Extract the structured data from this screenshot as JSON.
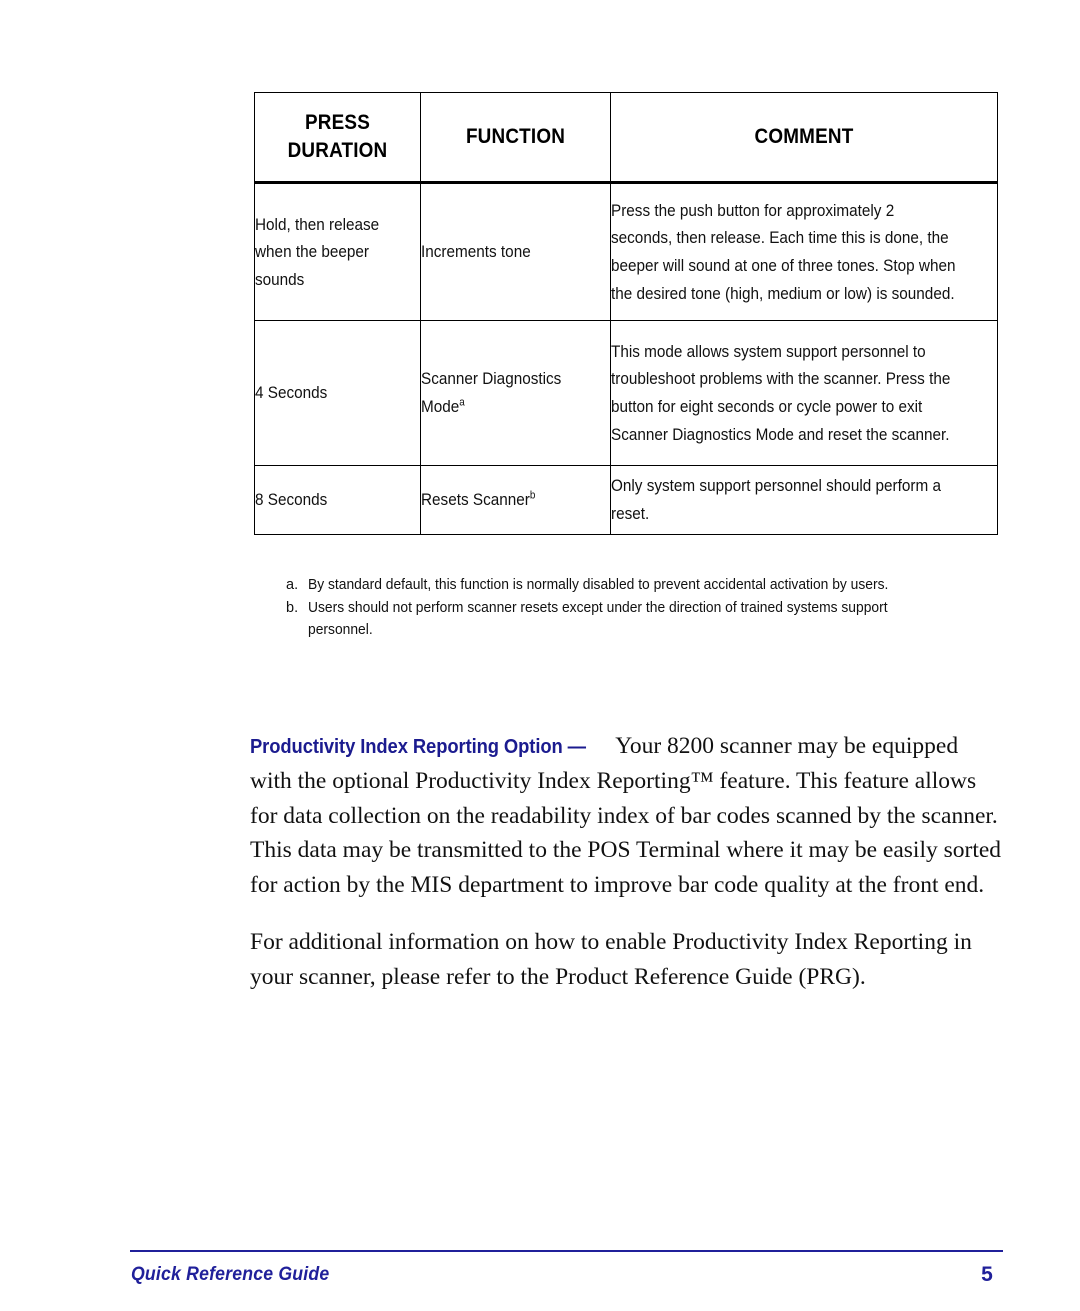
{
  "page": {
    "number": "5",
    "footer_title": "Quick Reference Guide",
    "accent_color": "#20209a",
    "lead_in_color": "#1b1b8f"
  },
  "table": {
    "headers": {
      "press_duration_line1": "PRESS",
      "press_duration_line2": "DURATION",
      "function": "FUNCTION",
      "comment": "COMMENT"
    },
    "rows": [
      {
        "duration": "Hold, then release when the beeper sounds",
        "function": "Increments tone",
        "function_footnote": "",
        "comment": "Press the push button for approximately 2 seconds, then release. Each time this is done, the beeper will sound at one of three tones. Stop when the desired tone (high, medium or low) is sounded."
      },
      {
        "duration": "4 Seconds",
        "function": "Scanner Diagnostics Mode",
        "function_footnote": "a",
        "comment": "This mode allows system support personnel to troubleshoot problems with the scanner. Press the button for eight seconds or cycle power to exit Scanner Diagnostics Mode and reset the scanner."
      },
      {
        "duration": "8 Seconds",
        "function": "Resets Scanner",
        "function_footnote": "b",
        "comment": "Only system support personnel should perform a reset."
      }
    ]
  },
  "footnotes": [
    {
      "mark": "a.",
      "text": "By standard default, this function is normally disabled to prevent accidental activation by users."
    },
    {
      "mark": "b.",
      "text": "Users should not perform scanner resets except under the direction of trained systems support personnel."
    }
  ],
  "body": {
    "paragraph1_lead_in": "Productivity Index Reporting Option —",
    "paragraph1_text": "Your 8200 scanner may be equipped with the optional Productivity Index Reporting™ feature. This feature allows for data collection on the readability index of bar codes scanned by the scanner. This data may be transmitted to the POS Terminal where it may be easily sorted for action by the MIS department to improve bar code quality at the front end.",
    "paragraph2_text": "For additional information on how to enable Productivity Index Reporting in your scanner, please refer to the Product Reference Guide (PRG)."
  }
}
